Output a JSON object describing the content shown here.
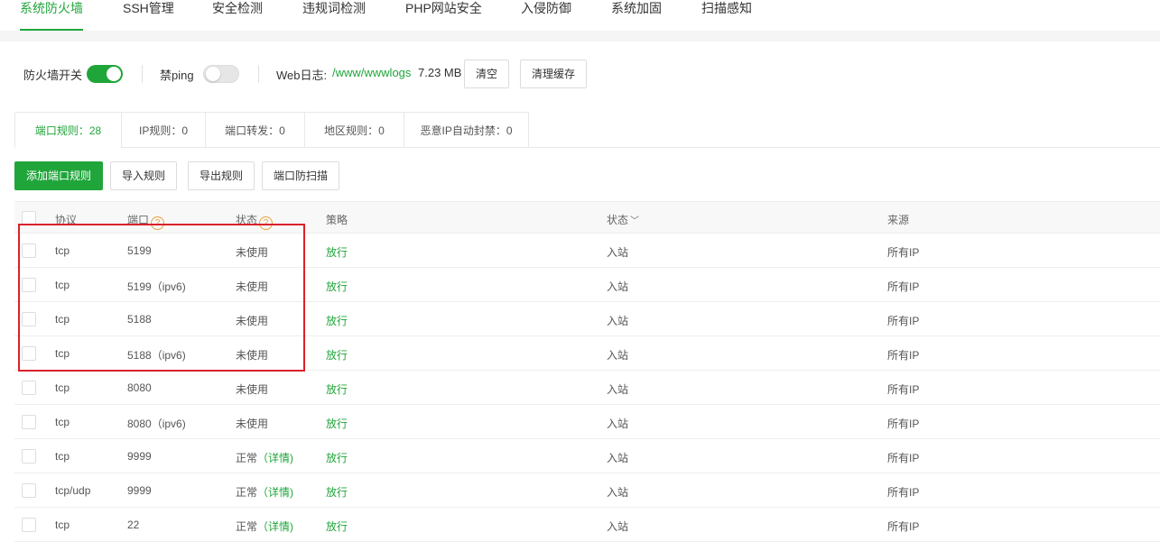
{
  "nav": {
    "tabs": [
      "系统防火墙",
      "SSH管理",
      "安全检测",
      "违规词检测",
      "PHP网站安全",
      "入侵防御",
      "系统加固",
      "扫描感知"
    ],
    "active_index": 0
  },
  "settings": {
    "firewall_label": "防火墙开关",
    "firewall_on": true,
    "ping_label": "禁ping",
    "ping_on": false,
    "weblog_label": "Web日志:",
    "weblog_path": "/www/wwwlogs",
    "weblog_size": "7.23 MB",
    "clear_label": "清空",
    "clear_cache_label": "清理缓存"
  },
  "rule_tabs": [
    "端口规则：28",
    "IP规则：0",
    "端口转发：0",
    "地区规则：0",
    "恶意IP自动封禁：0"
  ],
  "actions": {
    "add": "添加端口规则",
    "import": "导入规则",
    "export": "导出规则",
    "scan": "端口防扫描"
  },
  "table": {
    "headers": {
      "protocol": "协议",
      "port": "端口",
      "status": "状态",
      "strategy": "策略",
      "direction": "状态",
      "source": "来源"
    },
    "rows": [
      {
        "protocol": "tcp",
        "port": "5199",
        "status": "未使用",
        "detail": "",
        "strategy": "放行",
        "direction": "入站",
        "source": "所有IP"
      },
      {
        "protocol": "tcp",
        "port": "5199（ipv6)",
        "status": "未使用",
        "detail": "",
        "strategy": "放行",
        "direction": "入站",
        "source": "所有IP"
      },
      {
        "protocol": "tcp",
        "port": "5188",
        "status": "未使用",
        "detail": "",
        "strategy": "放行",
        "direction": "入站",
        "source": "所有IP"
      },
      {
        "protocol": "tcp",
        "port": "5188（ipv6)",
        "status": "未使用",
        "detail": "",
        "strategy": "放行",
        "direction": "入站",
        "source": "所有IP"
      },
      {
        "protocol": "tcp",
        "port": "8080",
        "status": "未使用",
        "detail": "",
        "strategy": "放行",
        "direction": "入站",
        "source": "所有IP"
      },
      {
        "protocol": "tcp",
        "port": "8080（ipv6)",
        "status": "未使用",
        "detail": "",
        "strategy": "放行",
        "direction": "入站",
        "source": "所有IP"
      },
      {
        "protocol": "tcp",
        "port": "9999",
        "status": "正常",
        "detail": "（详情)",
        "strategy": "放行",
        "direction": "入站",
        "source": "所有IP"
      },
      {
        "protocol": "tcp/udp",
        "port": "9999",
        "status": "正常",
        "detail": "（详情)",
        "strategy": "放行",
        "direction": "入站",
        "source": "所有IP"
      },
      {
        "protocol": "tcp",
        "port": "22",
        "status": "正常",
        "detail": "（详情)",
        "strategy": "放行",
        "direction": "入站",
        "source": "所有IP"
      }
    ]
  },
  "colors": {
    "accent": "#20a53a",
    "highlight_box": "#d9222a",
    "help_icon": "#e6a23c"
  }
}
